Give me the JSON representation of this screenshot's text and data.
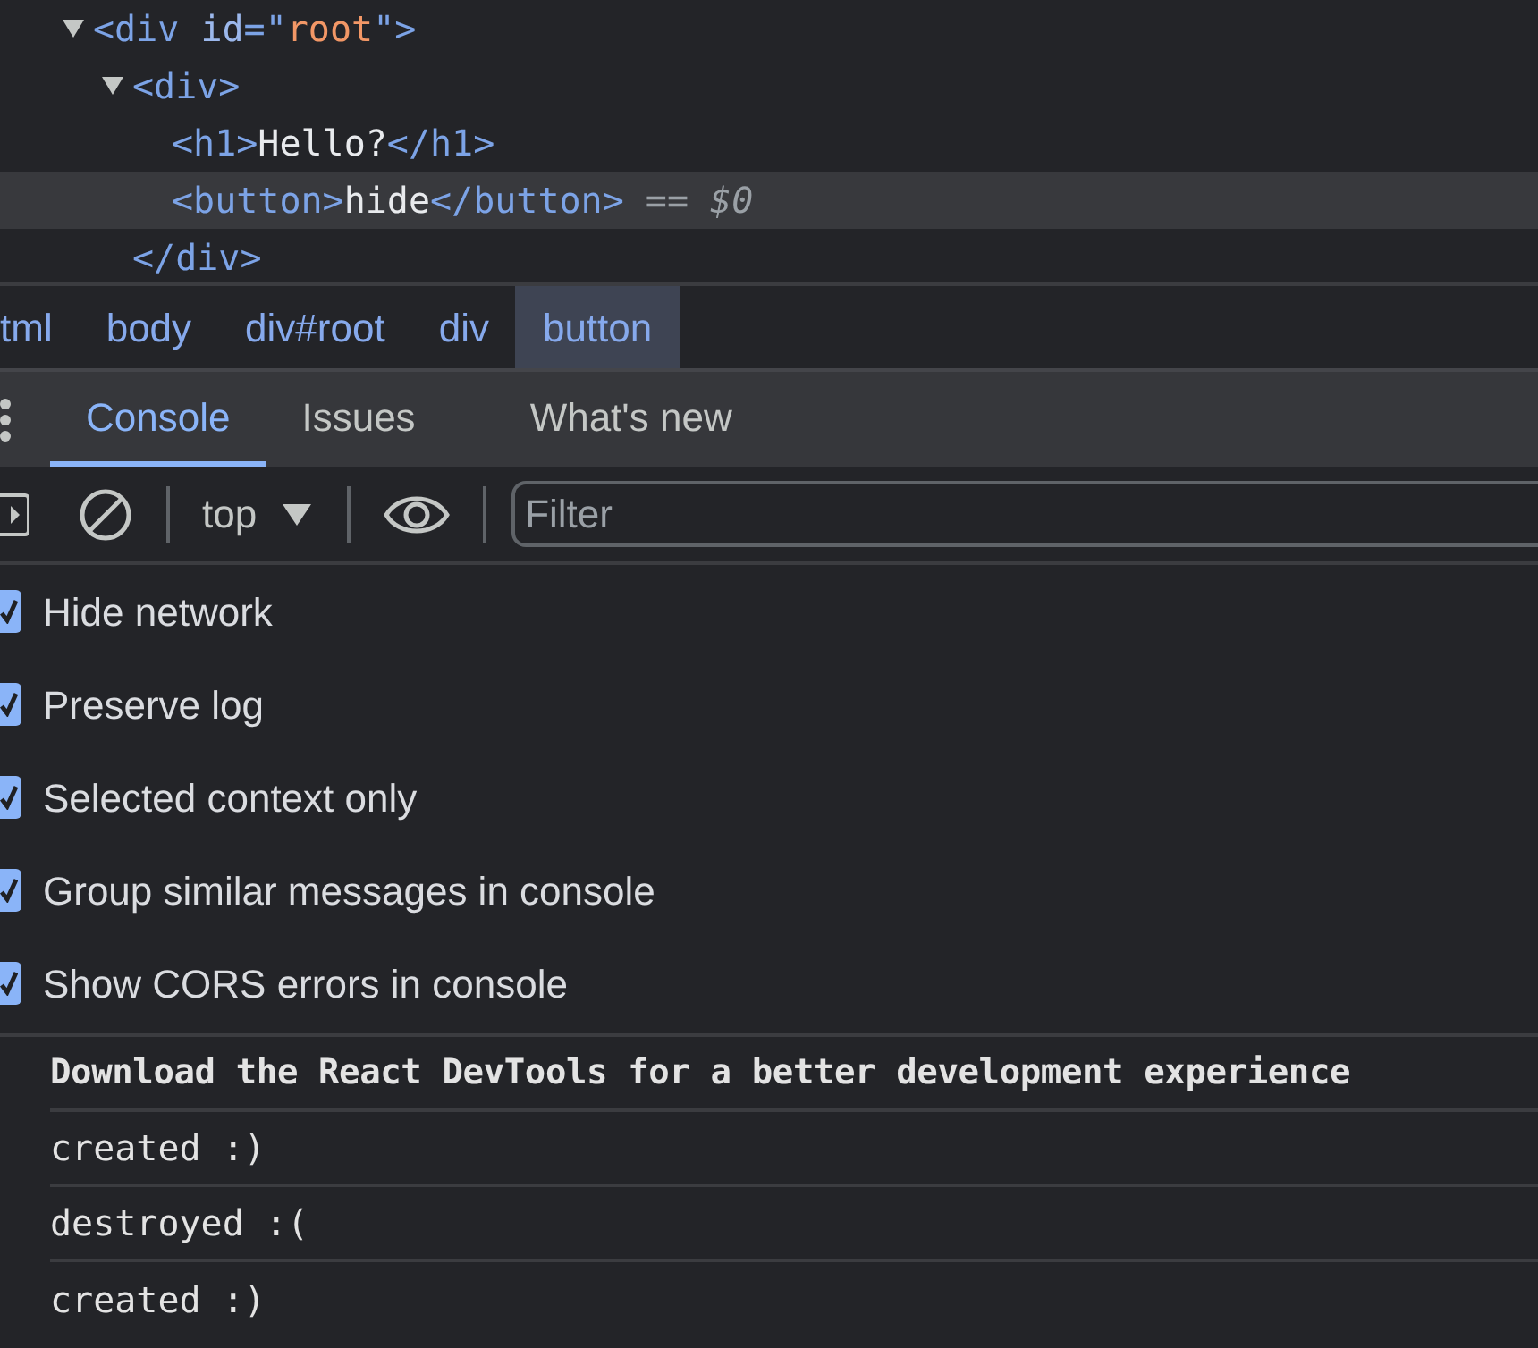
{
  "elements_tree": [
    {
      "expanded": true,
      "selected": false,
      "segments": [
        {
          "text": "<div",
          "kind": "tag"
        },
        {
          "text": " id",
          "kind": "attr"
        },
        {
          "text": "=\"",
          "kind": "tag"
        },
        {
          "text": "root",
          "kind": "value"
        },
        {
          "text": "\">",
          "kind": "tag"
        }
      ],
      "children": [
        {
          "expanded": true,
          "selected": false,
          "segments": [
            {
              "text": "<div>",
              "kind": "tag"
            }
          ],
          "children": [
            {
              "selected": false,
              "segments": [
                {
                  "text": "<h1>",
                  "kind": "tag"
                },
                {
                  "text": "Hello?",
                  "kind": "text"
                },
                {
                  "text": "</h1>",
                  "kind": "tag"
                }
              ]
            },
            {
              "selected": true,
              "segments": [
                {
                  "text": "<button>",
                  "kind": "tag"
                },
                {
                  "text": "hide",
                  "kind": "text"
                },
                {
                  "text": "</button>",
                  "kind": "tag"
                },
                {
                  "text": " == ",
                  "kind": "marker"
                },
                {
                  "text": "$0",
                  "kind": "ref"
                }
              ]
            }
          ],
          "closing": [
            {
              "text": "</div>",
              "kind": "tag"
            }
          ]
        }
      ]
    }
  ],
  "breadcrumbs": [
    {
      "label": "tml",
      "selected": false
    },
    {
      "label": "body",
      "selected": false
    },
    {
      "label": "div#root",
      "selected": false
    },
    {
      "label": "div",
      "selected": false
    },
    {
      "label": "button",
      "selected": true
    }
  ],
  "drawer_tabs": [
    {
      "label": "Console",
      "selected": true
    },
    {
      "label": "Issues",
      "selected": false
    },
    {
      "label": "What's new",
      "selected": false
    }
  ],
  "toolbar": {
    "context": "top",
    "filter": {
      "placeholder": "Filter"
    }
  },
  "settings": [
    {
      "label": "Hide network",
      "checked": true
    },
    {
      "label": "Preserve log",
      "checked": true
    },
    {
      "label": "Selected context only",
      "checked": true
    },
    {
      "label": "Group similar messages in console",
      "checked": true
    },
    {
      "label": "Show CORS errors in console",
      "checked": true
    }
  ],
  "messages": [
    {
      "text": "Download the React DevTools for a better development experience",
      "kind": "banner"
    },
    {
      "text": "created :)",
      "kind": "log"
    },
    {
      "text": "destroyed :(",
      "kind": "log"
    },
    {
      "text": "created :)",
      "kind": "log"
    }
  ]
}
